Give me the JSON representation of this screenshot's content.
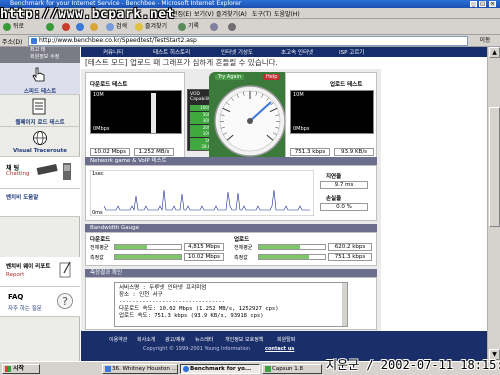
{
  "window": {
    "title": "Benchmark for your Internet Service - Benchbee - Microsoft Internet Explorer",
    "watermark": "http://www.bcpark.net"
  },
  "menu": [
    "파일(F)",
    "편집(E)",
    "보기(V)",
    "즐겨찾기(A)",
    "도구(T)",
    "도움말(H)"
  ],
  "toolbar": {
    "back": "뒤로",
    "search": "검색",
    "favorites": "즐겨찾기",
    "history": "기록"
  },
  "address": {
    "label": "주소(D)",
    "url": "http://www.benchbee.co.kr/Speedtest/TestStart2.asp",
    "go": "이동"
  },
  "sidebar": {
    "top_tab_line1": "최고 테",
    "top_tab_line2": "회원정보 수정",
    "speed_test": "스피드 테스트",
    "webpage_test": "웹페이지 로드 테스트",
    "visual_traceroute": "Visual Traceroute",
    "chatting_label": "채 팅",
    "chatting_en": "Chatting",
    "help_label": "벤치비 도움말",
    "report_label": "벤치비 웨이 리포트",
    "report_en": "Report",
    "faq_label": "FAQ",
    "faq_sub": "자주 하는 질문"
  },
  "topnav": [
    "커뮤니티",
    "테스트 히스토리",
    "인터넷 기상도",
    "초고속 인터넷",
    "ISP 고르기"
  ],
  "notice": "[테스트 모드] 업로드 때 그래프가 심하게 흔들릴 수 있습니다.",
  "speed": {
    "download_title": "다운로드 테스트",
    "upload_title": "업로드 테스트",
    "graph_max": "10M",
    "graph_min": "0Mbps",
    "download_mbps": "10.02 Mbps",
    "download_mbs": "1.252 MB/s",
    "upload_kbps": "751.3 kbps",
    "upload_kbs": "93.9 KB/s",
    "vod_label": "VOD Capability",
    "vod_levels": [
      "1000K",
      "500K",
      "300K",
      "200K",
      "100K",
      "56K",
      "28.8K"
    ],
    "try_again": "Try Again",
    "help_tab": "Help"
  },
  "network": {
    "title": "Network game & VoIP 테스트",
    "graph_max": "1sec",
    "graph_min": "0ms",
    "latency_label": "지연율",
    "latency_value": "9.7 ms",
    "loss_label": "손실율",
    "loss_value": "0.0 %"
  },
  "gauge_section": {
    "title": "Bandwidth Gauge",
    "download_head": "다운로드",
    "upload_head": "업로드",
    "avg_label": "전체평균",
    "measured_label": "측정값",
    "dl_avg": "4,815 Mbps",
    "dl_measured": "10.02 Mbps",
    "ul_avg": "620.2 kbps",
    "ul_measured": "751.3 kbps",
    "dl_avg_fill": 0.48,
    "dl_measured_fill": 1.0,
    "ul_avg_fill": 0.62,
    "ul_measured_fill": 0.75
  },
  "result": {
    "title": "측정결과 확인",
    "line1_label": "서비스명 :",
    "line1_value": "두루넷 인터넷 프리미엄",
    "line2_label": "장소 :",
    "line2_value": "인천 서구",
    "divider": "--------------------------------",
    "line3_label": "다운로드 속도:",
    "line3_value": "10.02 Mbps (1.252 MB/s, 1252927 cps)",
    "line4_label": "업로드 속도:",
    "line4_value": "751.3 kbps (93.9 KB/s, 93918 cps)"
  },
  "footer": {
    "links": [
      "이용약관",
      "회사소개",
      "광고/제휴",
      "뉴스레터",
      "개인정보 보호정책",
      "회원탈퇴"
    ],
    "copyright": "Copyright © 1999-2001 Young Information",
    "contact": "contact us"
  },
  "taskbar": {
    "start": "시작",
    "tasks": [
      "36. Whitney Houston ...",
      "Benchmark for yo...",
      "Capsun 1.8"
    ],
    "stamp": "지운군 / 2002-07-11 18:15:51"
  },
  "colors": {
    "nav_blue": "#152d6a",
    "section_gray": "#6b6f8d",
    "bar_green": "#7fc56b",
    "graph_black": "#000000"
  }
}
